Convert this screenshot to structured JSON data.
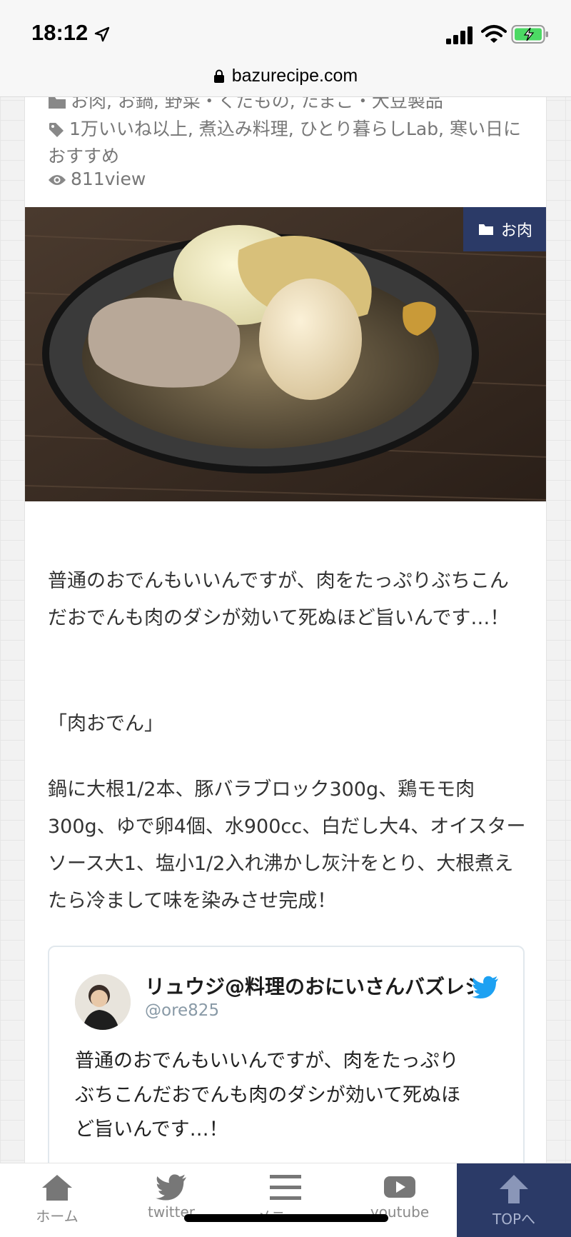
{
  "status_bar": {
    "time": "18:12",
    "icons": [
      "location-arrow-icon",
      "signal-icon",
      "wifi-icon",
      "battery-charging-icon"
    ]
  },
  "browser": {
    "url": "bazurecipe.com",
    "icon": "lock-icon"
  },
  "article": {
    "categories_text": "お肉, お鍋, 野菜・くだもの, たまご・大豆製品",
    "tags_text": "1万いいね以上, 煮込み料理, ひとり暮らしLab, 寒い日におすすめ",
    "views": "811view",
    "hero": {
      "category_badge": "お肉",
      "accent_color": "#2b3a67"
    },
    "paragraphs": {
      "p1": "普通のおでんもいいんですが、肉をたっぷりぶちこんだおでんも肉のダシが効いて死ぬほど旨いんです…！",
      "p2": "「肉おでん」",
      "p3": "鍋に大根1/2本、豚バラブロック300g、鶏モモ肉300g、ゆで卵4個、水900cc、白だし大4、オイスターソース大1、塩小1/2入れ沸かし灰汁をとり、大根煮えたら冷まして味を染みさせ完成！"
    }
  },
  "tweet": {
    "name": "リュウジ@料理のおにいさんバズレシピ",
    "handle": "@ore825",
    "text": "普通のおでんもいいんですが、肉をたっぷりぶちこんだおでんも肉のダシが効いて死ぬほど旨いんです…！",
    "brand_color": "#1da1f2"
  },
  "bottom_nav": {
    "home": "ホーム",
    "twitter": "twitter",
    "menu": "メニュー",
    "youtube": "youtube",
    "top": "TOPへ"
  }
}
